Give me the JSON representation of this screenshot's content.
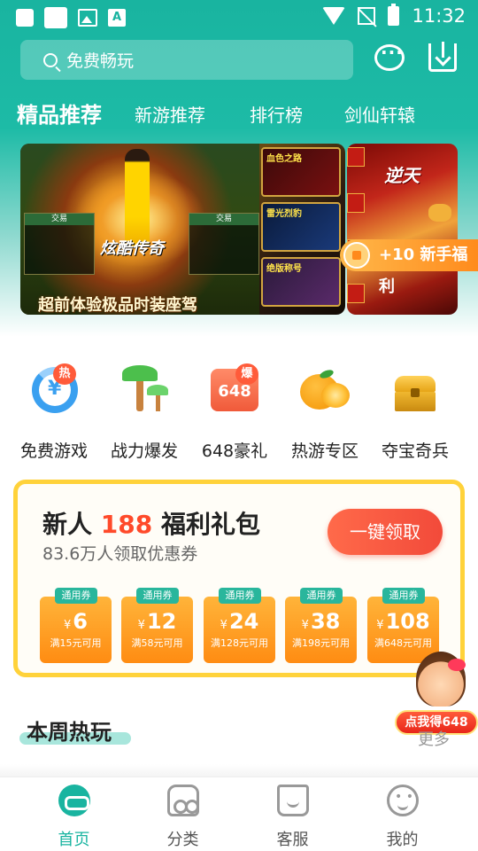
{
  "status_bar": {
    "time": "11:32",
    "notification_letter": "A"
  },
  "search": {
    "placeholder_text": "免费畅玩"
  },
  "tabs": [
    {
      "label": "精品推荐",
      "active": true
    },
    {
      "label": "新游推荐",
      "active": false
    },
    {
      "label": "排行榜",
      "active": false
    },
    {
      "label": "剑仙轩辕",
      "active": false
    }
  ],
  "banner": {
    "main_caption": "超前体验极品时装座驾",
    "main_logo": "炫酷传奇",
    "main_panel_header": "交易",
    "main_cards": [
      "血色之路",
      "雷光烈豹",
      "绝版称号"
    ],
    "side_text": "逆天"
  },
  "new_user_pill": {
    "label": "+10 新手福利"
  },
  "categories": [
    {
      "label": "免费游戏",
      "badge": "热",
      "icon": "wallet-coin-icon"
    },
    {
      "label": "战力爆发",
      "badge": "",
      "icon": "palm-tree-icon"
    },
    {
      "label": "648豪礼",
      "badge": "爆",
      "icon": "gift-box-648-icon",
      "icon_text": "648"
    },
    {
      "label": "热游专区",
      "badge": "",
      "icon": "orange-icon"
    },
    {
      "label": "夺宝奇兵",
      "badge": "",
      "icon": "treasure-chest-icon"
    }
  ],
  "gift_pack": {
    "title_prefix": "新人 ",
    "title_number": "188",
    "title_suffix": " 福利礼包",
    "subtitle": "83.6万人领取优惠券",
    "claim_button": "一键领取",
    "coupons": [
      {
        "tag": "通用券",
        "yen": "¥",
        "value": "6",
        "condition": "满15元可用"
      },
      {
        "tag": "通用券",
        "yen": "¥",
        "value": "12",
        "condition": "满58元可用"
      },
      {
        "tag": "通用券",
        "yen": "¥",
        "value": "24",
        "condition": "满128元可用"
      },
      {
        "tag": "通用券",
        "yen": "¥",
        "value": "38",
        "condition": "满198元可用"
      },
      {
        "tag": "通用券",
        "yen": "¥",
        "value": "108",
        "condition": "满648元可用"
      }
    ]
  },
  "floating_promo": {
    "label": "点我得648"
  },
  "weekly_hot": {
    "title": "本周热玩",
    "more": "更多"
  },
  "bottom_nav": [
    {
      "label": "首页",
      "active": true
    },
    {
      "label": "分类",
      "active": false
    },
    {
      "label": "客服",
      "active": false
    },
    {
      "label": "我的",
      "active": false
    }
  ],
  "colors": {
    "brand": "#19b4a0",
    "accent": "#ff4a2a",
    "coupon": "#ff9a1c"
  }
}
